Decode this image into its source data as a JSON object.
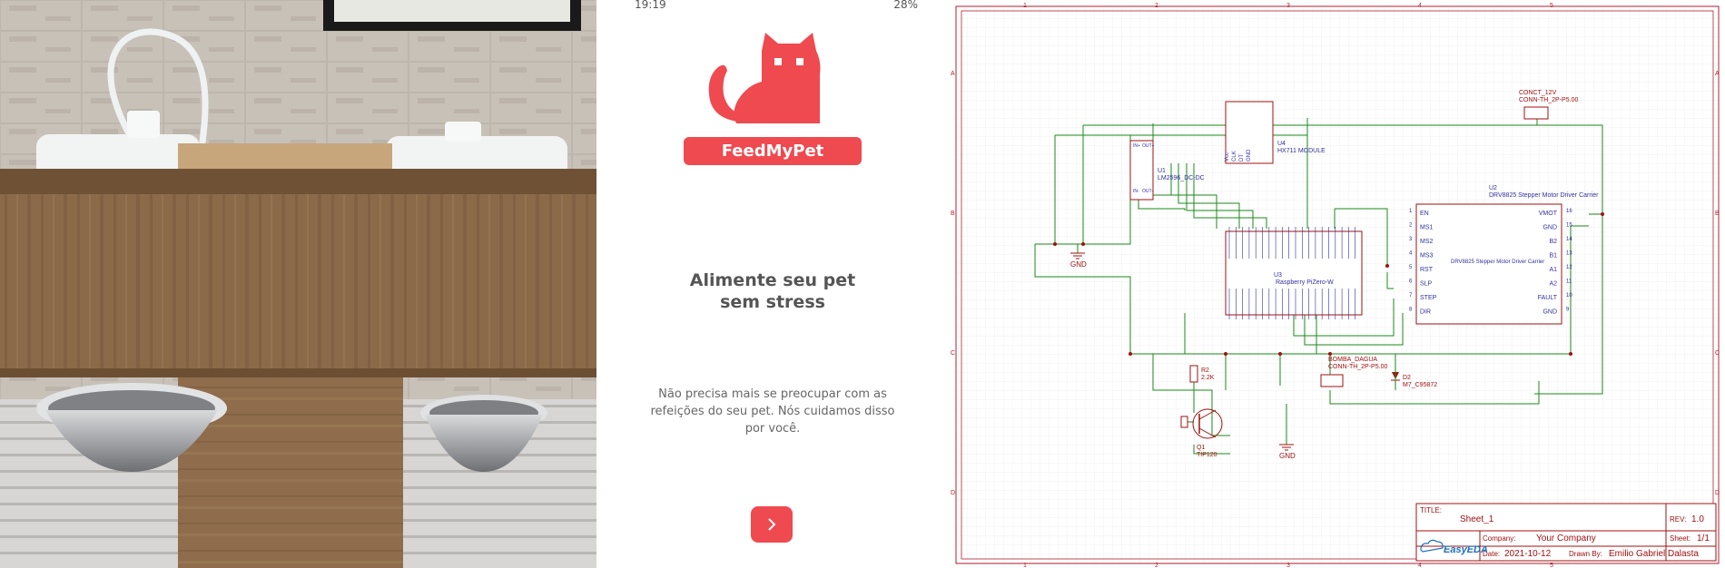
{
  "phone": {
    "status_time": "19:19",
    "status_battery": "28%",
    "brand_name": "FeedMyPet",
    "headline_line1": "Alimente seu pet",
    "headline_line2": "sem stress",
    "body_text": "Não precisa mais se preocupar com as refeições do seu pet. Nós cuidamos disso por você.",
    "logo_icon": "cat-icon",
    "next_icon": "chevron-right-icon",
    "accent_color": "#ee4a50"
  },
  "schematic": {
    "colors": {
      "border": "#b02030",
      "wire": "#1a8a1a",
      "component": "#a01010",
      "pin": "#3030a0"
    },
    "frame_letters": [
      "A",
      "B",
      "C",
      "D"
    ],
    "frame_numbers": [
      "1",
      "2",
      "3",
      "4",
      "5"
    ],
    "components": {
      "u1_ref": "U1",
      "u1_name": "LM2596_DC-DC",
      "u1_pins": [
        "IN+",
        "IN-",
        "OUT+",
        "OUT-"
      ],
      "u4_ref": "U4",
      "u4_name": "HX711 MODULE",
      "u4_pins": [
        "Vcc",
        "CLK",
        "DT",
        "GND"
      ],
      "u3_ref": "U3",
      "u3_name": "Raspberry PiZero-W",
      "u2_ref": "U2",
      "u2_name": "DRV8825 Stepper Motor Driver Carrier",
      "u2_inner": "DRV8825 Stepper Motor Driver Carrier",
      "u2_left_pins": [
        "EN",
        "MS1",
        "MS2",
        "MS3",
        "RST",
        "SLP",
        "STEP",
        "DIR"
      ],
      "u2_left_nums": [
        "1",
        "2",
        "3",
        "4",
        "5",
        "6",
        "7",
        "8"
      ],
      "u2_right_pins": [
        "VMOT",
        "GND",
        "B2",
        "B1",
        "A1",
        "A2",
        "FAULT",
        "GND"
      ],
      "u2_right_nums": [
        "16",
        "15",
        "14",
        "13",
        "12",
        "11",
        "10",
        "9"
      ],
      "conn_ref": "CONCT_12V",
      "conn_name": "CONN-TH_2P-P5.00",
      "bomba_ref": "BOMBA_DAGUA",
      "bomba_name": "CONN-TH_2P-P5.00",
      "r2_ref": "R2",
      "r2_value": "2.2K",
      "d2_ref": "D2",
      "d2_value": "M7_C95872",
      "q1_ref": "Q1",
      "q1_name": "TIP120",
      "gnd1": "GND",
      "gnd2": "GND"
    },
    "title_block": {
      "title_label": "TITLE:",
      "title_value": "Sheet_1",
      "rev_label": "REV:",
      "rev_value": "1.0",
      "company_label": "Company:",
      "company_value": "Your Company",
      "sheet_label": "Sheet:",
      "sheet_value": "1/1",
      "date_label": "Date:",
      "date_value": "2021-10-12",
      "drawn_label": "Drawn By:",
      "drawn_value": "Emilio Gabriel Dalasta",
      "brand": "EasyEDA"
    }
  }
}
